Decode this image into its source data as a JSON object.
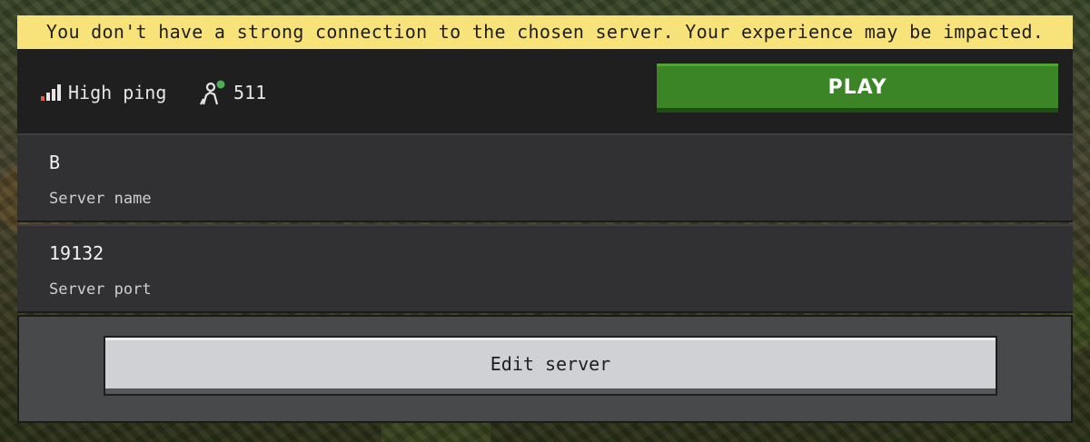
{
  "warning": {
    "text": "You don't have a strong connection to the chosen server. Your experience may be impacted.",
    "background_color": "#f8e27a"
  },
  "status": {
    "ping_icon": "signal-bars-icon",
    "ping_label": "High ping",
    "players_icon": "players-online-icon",
    "player_count": "511"
  },
  "play_button": {
    "label": "PLAY",
    "color": "#3c8527"
  },
  "server": {
    "name_value": "B",
    "name_label": "Server name",
    "port_value": "19132",
    "port_label": "Server port"
  },
  "edit_button": {
    "label": "Edit server"
  }
}
